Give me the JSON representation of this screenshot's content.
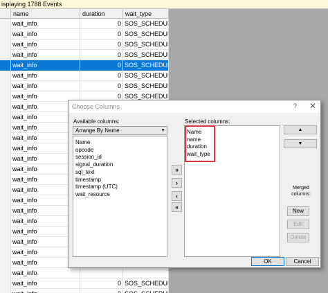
{
  "status": {
    "text": "isplaying 1788 Events"
  },
  "grid": {
    "columns": [
      "name",
      "duration",
      "wait_type"
    ],
    "rows": [
      {
        "name": "wait_info",
        "duration": "0",
        "wait_type": "SOS_SCHEDUL..."
      },
      {
        "name": "wait_info",
        "duration": "0",
        "wait_type": "SOS_SCHEDUL..."
      },
      {
        "name": "wait_info",
        "duration": "0",
        "wait_type": "SOS_SCHEDUL..."
      },
      {
        "name": "wait_info",
        "duration": "0",
        "wait_type": "SOS_SCHEDUL..."
      },
      {
        "name": "wait_info",
        "duration": "0",
        "wait_type": "SOS_SCHEDUL..."
      },
      {
        "name": "wait_info",
        "duration": "0",
        "wait_type": "SOS_SCHEDUL..."
      },
      {
        "name": "wait_info",
        "duration": "0",
        "wait_type": "SOS_SCHEDUL..."
      },
      {
        "name": "wait_info",
        "duration": "0",
        "wait_type": "SOS_SCHEDUL..."
      },
      {
        "name": "wait_info",
        "duration": "",
        "wait_type": ""
      },
      {
        "name": "wait_info",
        "duration": "",
        "wait_type": ""
      },
      {
        "name": "wait_info",
        "duration": "",
        "wait_type": ""
      },
      {
        "name": "wait_info",
        "duration": "",
        "wait_type": ""
      },
      {
        "name": "wait_info",
        "duration": "",
        "wait_type": ""
      },
      {
        "name": "wait_info",
        "duration": "",
        "wait_type": ""
      },
      {
        "name": "wait_info",
        "duration": "",
        "wait_type": ""
      },
      {
        "name": "wait_info",
        "duration": "",
        "wait_type": ""
      },
      {
        "name": "wait_info",
        "duration": "",
        "wait_type": ""
      },
      {
        "name": "wait_info",
        "duration": "",
        "wait_type": ""
      },
      {
        "name": "wait_info",
        "duration": "",
        "wait_type": ""
      },
      {
        "name": "wait_info",
        "duration": "",
        "wait_type": ""
      },
      {
        "name": "wait_info",
        "duration": "",
        "wait_type": ""
      },
      {
        "name": "wait_info",
        "duration": "",
        "wait_type": ""
      },
      {
        "name": "wait_info",
        "duration": "",
        "wait_type": ""
      },
      {
        "name": "wait_info",
        "duration": "",
        "wait_type": ""
      },
      {
        "name": "wait_info",
        "duration": "",
        "wait_type": ""
      },
      {
        "name": "wait_info",
        "duration": "0",
        "wait_type": "SOS_SCHEDUL..."
      },
      {
        "name": "wait_info",
        "duration": "0",
        "wait_type": "SOS_SCHEDUL..."
      }
    ],
    "selected_row": 4
  },
  "dialog": {
    "title": "Choose Columns",
    "help": "?",
    "close": "✕",
    "available_label": "Available columns:",
    "arrange": "Arrange By Name",
    "available": [
      "Name",
      "opcode",
      "session_id",
      "signal_duration",
      "sql_text",
      "timestamp",
      "timestamp (UTC)",
      "wait_resource"
    ],
    "selected_label": "Selected columns:",
    "selected": [
      "Name",
      "name",
      "duration",
      "wait_type"
    ],
    "move_all_right": "»",
    "move_right": "›",
    "move_left": "‹",
    "move_all_left": "«",
    "up": "▲",
    "down": "▼",
    "merged_label": "Merged columns:",
    "new": "New",
    "edit": "Edit",
    "delete": "Delete",
    "ok": "OK",
    "cancel": "Cancel"
  },
  "colors": {
    "selection": "#0a78d7",
    "highlight_box": "#e0353f",
    "status_bg": "#fdf8d7"
  }
}
